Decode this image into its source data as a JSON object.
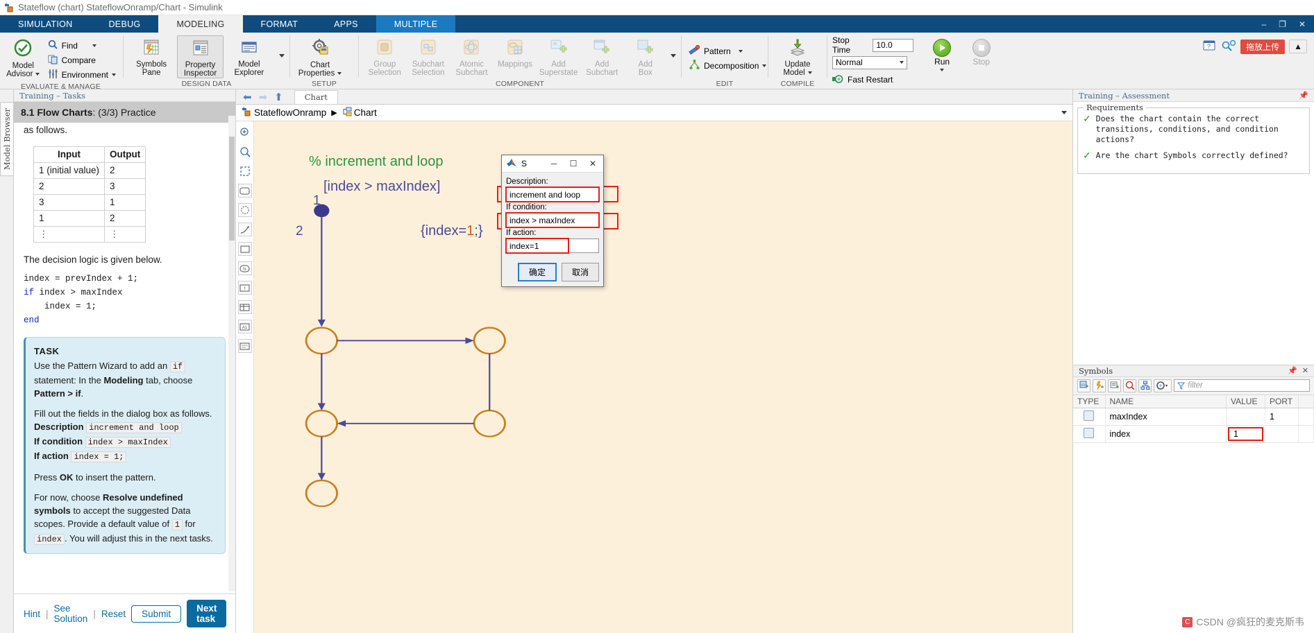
{
  "window": {
    "title": "Stateflow (chart) StateflowOnramp/Chart - Simulink",
    "icon": "stateflow-icon",
    "minimize": "–",
    "maximize": "❐",
    "close": "✕"
  },
  "ribbon": {
    "tabs": [
      {
        "label": "SIMULATION",
        "active": false
      },
      {
        "label": "DEBUG",
        "active": false
      },
      {
        "label": "MODELING",
        "active": true
      },
      {
        "label": "FORMAT",
        "active": false
      },
      {
        "label": "APPS",
        "active": false
      },
      {
        "label": "MULTIPLE",
        "active": false,
        "highlight": true
      }
    ],
    "corner": {
      "upload_badge": "拖放上传",
      "help_icon": "help-icon",
      "search_icon": "search-icon",
      "collapse_icon": "chevron-up-icon"
    },
    "groups": [
      {
        "title": "EVALUATE & MANAGE",
        "big": [
          {
            "label_line1": "Model",
            "label_line2": "Advisor",
            "icon": "model-advisor-icon",
            "caret": true
          }
        ],
        "small": [
          {
            "label": "Find",
            "icon": "search-icon",
            "caret": true
          },
          {
            "label": "Compare",
            "icon": "compare-icon",
            "caret": false
          },
          {
            "label": "Environment",
            "icon": "environment-icon",
            "caret": true
          }
        ]
      },
      {
        "title": "DESIGN DATA",
        "big": [
          {
            "label_line1": "Symbols",
            "label_line2": "Pane",
            "icon": "symbols-pane-icon"
          },
          {
            "label_line1": "Property",
            "label_line2": "Inspector",
            "icon": "property-inspector-icon",
            "selected": true
          },
          {
            "label_line1": "Model",
            "label_line2": "Explorer",
            "icon": "model-explorer-icon"
          }
        ]
      },
      {
        "title": "SETUP",
        "big": [
          {
            "label_line1": "Chart",
            "label_line2": "Properties",
            "icon": "chart-properties-icon",
            "caret": true
          }
        ]
      },
      {
        "title": "COMPONENT",
        "big": [
          {
            "label_line1": "Group",
            "label_line2": "Selection",
            "icon": "group-selection-icon",
            "disabled": true
          },
          {
            "label_line1": "Subchart",
            "label_line2": "Selection",
            "icon": "subchart-selection-icon",
            "disabled": true
          },
          {
            "label_line1": "Atomic",
            "label_line2": "Subchart",
            "icon": "atomic-subchart-icon",
            "disabled": true
          },
          {
            "label_line1": "Mappings",
            "label_line2": "",
            "icon": "mappings-icon",
            "disabled": true
          },
          {
            "label_line1": "Add",
            "label_line2": "Superstate",
            "icon": "add-superstate-icon",
            "disabled": true
          },
          {
            "label_line1": "Add",
            "label_line2": "Subchart",
            "icon": "add-subchart-icon",
            "disabled": true
          },
          {
            "label_line1": "Add",
            "label_line2": "Box",
            "icon": "add-box-icon",
            "disabled": true
          }
        ]
      },
      {
        "title": "EDIT",
        "small": [
          {
            "label": "Pattern",
            "icon": "pattern-icon",
            "caret": true
          },
          {
            "label": "Decomposition",
            "icon": "decomposition-icon",
            "caret": true
          }
        ]
      },
      {
        "title": "COMPILE",
        "big": [
          {
            "label_line1": "Update",
            "label_line2": "Model",
            "icon": "update-model-icon",
            "caret": true
          }
        ]
      },
      {
        "title": "SIMULATE",
        "stop_time_label": "Stop Time",
        "stop_time_value": "10.0",
        "sim_mode": "Normal",
        "fast_restart_label": "Fast Restart",
        "run_label": "Run",
        "stop_label": "Stop"
      }
    ]
  },
  "left_strip": {
    "label": "Model Browser"
  },
  "task_panel": {
    "title": "Training – Tasks",
    "heading_bold": "8.1 Flow Charts",
    "heading_rest": ": (3/3) Practice",
    "intro_fragment": "as follows.",
    "table": {
      "headers": [
        "Input",
        "Output"
      ],
      "rows": [
        [
          "1 (initial value)",
          "2"
        ],
        [
          "2",
          "3"
        ],
        [
          "3",
          "1"
        ],
        [
          "1",
          "2"
        ],
        [
          "⋮",
          "⋮"
        ]
      ]
    },
    "logic_intro": "The decision logic is given below.",
    "code": [
      {
        "text": "index = prevIndex + 1;",
        "kw": ""
      },
      {
        "text": " index > maxIndex",
        "kw": "if"
      },
      {
        "text": "    index = 1;",
        "kw": ""
      },
      {
        "text": "",
        "kw": "end"
      }
    ],
    "taskbox": {
      "header": "TASK",
      "p1_a": "Use the Pattern Wizard to add an ",
      "p1_code": "if",
      "p1_b": " statement: In the ",
      "p1_bold1": "Modeling",
      "p1_c": " tab, choose ",
      "p1_bold2": "Pattern > if",
      "p1_d": ".",
      "p2": "Fill out the fields in the dialog box as follows.",
      "fields": [
        {
          "label": "Description",
          "value": "increment and loop"
        },
        {
          "label": "If condition",
          "value": "index > maxIndex"
        },
        {
          "label": "If action",
          "value": "index = 1;"
        }
      ],
      "p3_a": "Press ",
      "p3_bold": "OK",
      "p3_b": " to insert the pattern.",
      "p4_a": "For now, choose ",
      "p4_bold": "Resolve undefined symbols",
      "p4_b": " to accept the suggested Data scopes. Provide a default value of ",
      "p4_code1": "1",
      "p4_c": " for ",
      "p4_code2": "index",
      "p4_d": ". You will adjust this in the next tasks."
    },
    "footer": {
      "hint": "Hint",
      "see_solution": "See Solution",
      "reset": "Reset",
      "submit": "Submit",
      "next_task": "Next task"
    }
  },
  "canvas": {
    "nav": {
      "back_icon": "back-arrow-icon",
      "forward_icon": "forward-arrow-icon",
      "up_icon": "up-arrow-icon",
      "tab_label": "Chart"
    },
    "breadcrumb": {
      "root": "StateflowOnramp",
      "separator": "▶",
      "leaf": "Chart"
    },
    "tools": [
      "zoom-in-icon",
      "fit-to-view-icon",
      "state-icon",
      "history-junction-icon",
      "transition-icon",
      "box-icon",
      "function-icon",
      "graphical-function-icon",
      "truth-table-icon",
      "matlab-function-icon",
      "simulink-function-icon",
      "annotation-icon"
    ],
    "chart": {
      "comment": "% increment and loop",
      "condition": "[index > maxIndex]",
      "action": "{index=1;}",
      "label_1": "1",
      "label_2": "2"
    }
  },
  "dialog": {
    "title": "S",
    "icon": "matlab-icon",
    "minimize": "─",
    "maximize": "☐",
    "close": "✕",
    "fields": [
      {
        "label": "Description:",
        "value": "increment and loop",
        "highlighted": true
      },
      {
        "label": "If condition:",
        "value": "index > maxIndex",
        "highlighted": true
      },
      {
        "label": "If action:",
        "value": "index=1",
        "highlighted": true
      }
    ],
    "ok": "确定",
    "cancel": "取消"
  },
  "assessment": {
    "title": "Training – Assessment",
    "legend": "Requirements",
    "items": [
      {
        "status": "✓",
        "text": "Does the chart contain the correct transitions, conditions, and condition actions?"
      },
      {
        "status": "✓",
        "text": "Are the chart Symbols correctly defined?"
      }
    ]
  },
  "symbols": {
    "title": "Symbols",
    "pin_icon": "pin-icon",
    "close_icon": "close-icon",
    "toolbar_icons": [
      "add-data-icon",
      "add-event-icon",
      "add-message-icon",
      "find-unused-icon",
      "resolve-symbols-icon",
      "settings-icon"
    ],
    "filter_placeholder": "filter",
    "columns": [
      "TYPE",
      "NAME",
      "VALUE",
      "PORT"
    ],
    "rows": [
      {
        "type_icon": "input-data-icon",
        "name": "maxIndex",
        "value": "",
        "port": "1",
        "value_highlighted": false
      },
      {
        "type_icon": "local-data-icon",
        "name": "index",
        "value": "1",
        "port": "",
        "value_highlighted": true
      }
    ]
  },
  "watermark": {
    "text": "CSDN @疯狂的麦克斯韦"
  },
  "colors": {
    "ribbon_blue": "#0e4c7e",
    "tab_highlight": "#1a7ac0",
    "canvas_bg": "#fdf0da",
    "accent_red": "#ee1c0f",
    "link_blue": "#0b6ba0",
    "state_border": "#b8762a",
    "transition": "#4a4a9a",
    "comment_green": "#2e9440"
  }
}
